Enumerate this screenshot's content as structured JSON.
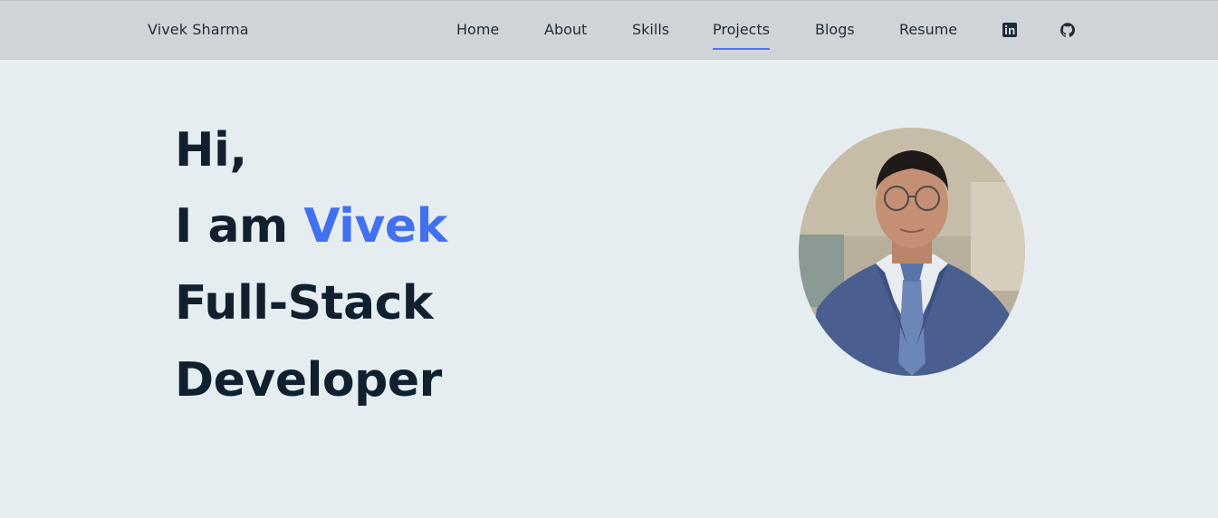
{
  "nav": {
    "brand": "Vivek Sharma",
    "links": [
      {
        "label": "Home"
      },
      {
        "label": "About"
      },
      {
        "label": "Skills"
      },
      {
        "label": "Projects",
        "active": true
      },
      {
        "label": "Blogs"
      },
      {
        "label": "Resume"
      }
    ],
    "icons": [
      "linkedin-icon",
      "github-icon"
    ]
  },
  "hero": {
    "greeting": "Hi,",
    "intro_prefix": "I am",
    "name": "Vivek",
    "role_line1": "Full-Stack",
    "role_line2": "Developer"
  },
  "colors": {
    "accent": "#4270ee",
    "heading": "#11202e",
    "nav_bg": "#cfd4d8",
    "page_bg": "#e6edf1"
  }
}
